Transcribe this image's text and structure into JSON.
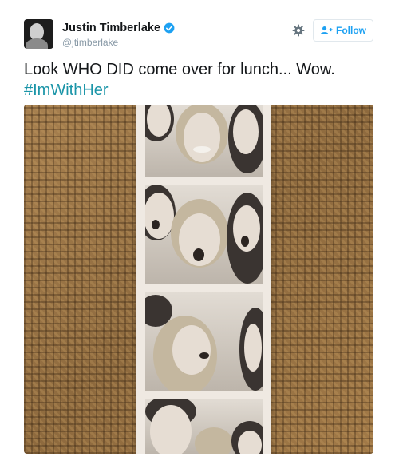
{
  "header": {
    "display_name": "Justin Timberlake",
    "handle": "@jtimberlake",
    "follow_label": "Follow"
  },
  "tweet": {
    "text": "Look WHO DID come over for lunch... Wow.",
    "hashtag": "#ImWithHer"
  },
  "icons": {
    "verified": "verified-badge-icon",
    "settings": "gear-icon",
    "follow": "add-user-icon"
  },
  "colors": {
    "link": "#1b95a8",
    "verified": "#1da1f2",
    "follow_text": "#1da1f2"
  }
}
